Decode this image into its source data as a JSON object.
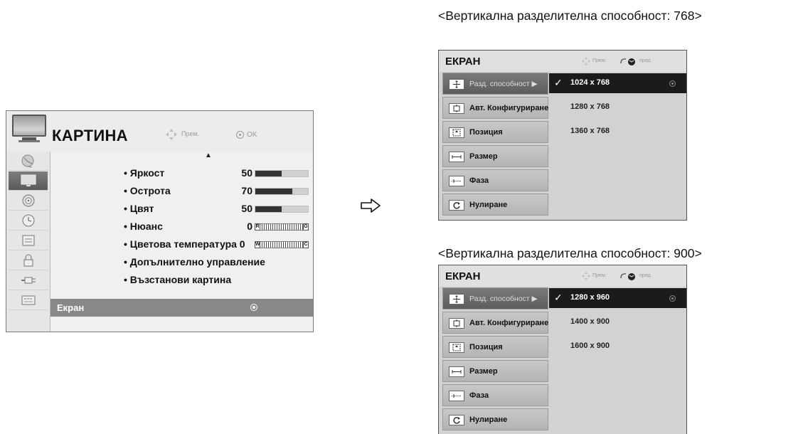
{
  "picture_menu": {
    "title": "КАРТИНА",
    "hint_move": "Прем.",
    "hint_ok": "OK",
    "sidebar_icons": [
      "satellite-dish-icon",
      "tv-icon",
      "speaker-icon",
      "clock-icon",
      "lock-settings-icon",
      "padlock-icon",
      "input-plug-icon",
      "usb-media-icon"
    ],
    "items": [
      {
        "label": "• Яркост",
        "value": "50",
        "level": 0.5
      },
      {
        "label": "• Острота",
        "value": "70",
        "level": 0.7
      },
      {
        "label": "• Цвят",
        "value": "50",
        "level": 0.5
      },
      {
        "label": "• Нюанс",
        "value": "0",
        "gauge_left": "R",
        "gauge_right": "G"
      },
      {
        "label": "• Цветова температура 0",
        "value": "",
        "gauge_left": "W",
        "gauge_right": "C"
      },
      {
        "label": "• Допълнително управление"
      },
      {
        "label": "• Възстанови картина"
      }
    ],
    "selected_item": "Екран"
  },
  "panels": [
    {
      "caption": "<Вертикална разделителна способност: 768>",
      "title": "ЕКРАН",
      "hint_move": "Прем.",
      "hint_back": "пред.",
      "menu": [
        {
          "label": "Разд. способност ▶",
          "icon": "resolution-icon"
        },
        {
          "label": "Авт. Конфигуриране",
          "icon": "auto-config-icon"
        },
        {
          "label": "Позиция",
          "icon": "position-icon"
        },
        {
          "label": "Размер",
          "icon": "size-icon"
        },
        {
          "label": "Фаза",
          "icon": "phase-icon"
        },
        {
          "label": "Нулиране",
          "icon": "reset-icon"
        }
      ],
      "options": [
        "1024 x 768",
        "1280 x 768",
        "1360 x 768"
      ],
      "selected_option": "1024 x 768"
    },
    {
      "caption": "<Вертикална разделителна способност: 900>",
      "title": "ЕКРАН",
      "hint_move": "Прем.",
      "hint_back": "пред.",
      "menu": [
        {
          "label": "Разд. способност ▶",
          "icon": "resolution-icon"
        },
        {
          "label": "Авт. Конфигуриране",
          "icon": "auto-config-icon"
        },
        {
          "label": "Позиция",
          "icon": "position-icon"
        },
        {
          "label": "Размер",
          "icon": "size-icon"
        },
        {
          "label": "Фаза",
          "icon": "phase-icon"
        },
        {
          "label": "Нулиране",
          "icon": "reset-icon"
        }
      ],
      "options": [
        "1280 x 960",
        "1400 x 900",
        "1600 x 900"
      ],
      "selected_option": "1280 x 960"
    }
  ]
}
